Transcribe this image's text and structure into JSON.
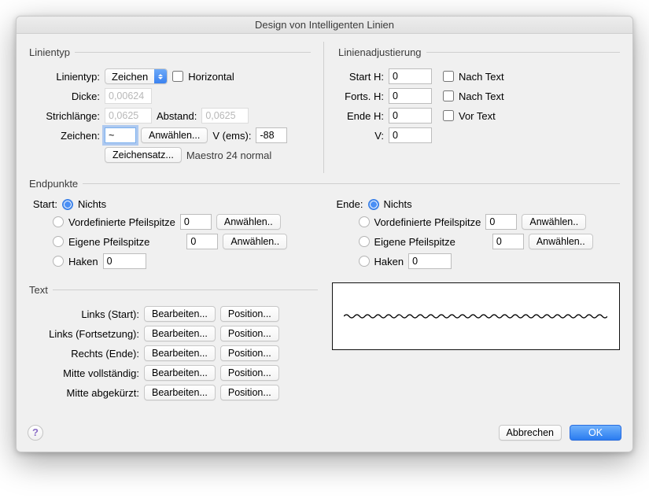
{
  "title": "Design von Intelligenten Linien",
  "linientyp": {
    "legend": "Linientyp",
    "linientyp_label": "Linientyp:",
    "linientyp_value": "Zeichen",
    "horizontal_label": "Horizontal",
    "dicke_label": "Dicke:",
    "dicke_value": "0,00624",
    "strichlaenge_label": "Strichlänge:",
    "strichlaenge_value": "0,0625",
    "abstand_label": "Abstand:",
    "abstand_value": "0,0625",
    "zeichen_label": "Zeichen:",
    "zeichen_value": "~",
    "anwaehlen": "Anwählen...",
    "v_ems_label": "V (ems):",
    "v_ems_value": "-88",
    "zeichensatz": "Zeichensatz...",
    "font_info": "Maestro 24 normal"
  },
  "adjust": {
    "legend": "Linienadjustierung",
    "start_h_label": "Start H:",
    "start_h_value": "0",
    "forts_h_label": "Forts. H:",
    "forts_h_value": "0",
    "ende_h_label": "Ende H:",
    "ende_h_value": "0",
    "v_label": "V:",
    "v_value": "0",
    "nach_text": "Nach Text",
    "vor_text": "Vor Text"
  },
  "endpoints": {
    "legend": "Endpunkte",
    "start_label": "Start:",
    "ende_label": "Ende:",
    "nichts": "Nichts",
    "vordef": "Vordefinierte Pfeilspitze",
    "eigene": "Eigene Pfeilspitze",
    "haken": "Haken",
    "anwaehlen": "Anwählen..",
    "val0": "0"
  },
  "text": {
    "legend": "Text",
    "links_start": "Links (Start):",
    "links_forts": "Links (Fortsetzung):",
    "rechts_ende": "Rechts (Ende):",
    "mitte_vollst": "Mitte vollständig:",
    "mitte_abgek": "Mitte abgekürzt:",
    "bearbeiten": "Bearbeiten...",
    "position": "Position..."
  },
  "footer": {
    "cancel": "Abbrechen",
    "ok": "OK"
  }
}
